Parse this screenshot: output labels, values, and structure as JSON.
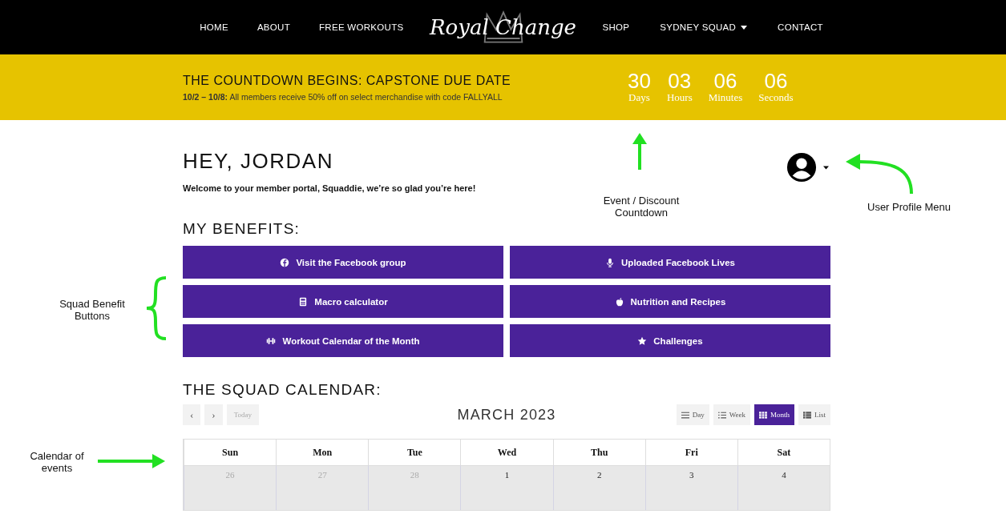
{
  "nav": {
    "left": [
      {
        "label": "HOME",
        "dropdown": false
      },
      {
        "label": "ABOUT",
        "dropdown": false
      },
      {
        "label": "FREE WORKOUTS",
        "dropdown": false
      }
    ],
    "logo": "Royal Change",
    "right": [
      {
        "label": "SHOP",
        "dropdown": false
      },
      {
        "label": "SYDNEY SQUAD",
        "dropdown": true
      },
      {
        "label": "CONTACT",
        "dropdown": false
      }
    ]
  },
  "banner": {
    "title": "THE COUNTDOWN BEGINS: CAPSTONE DUE DATE",
    "note": "**10/2 – 10/8:** All members receive 50% off on select merchandise with code FALLYALL",
    "countdown": [
      {
        "value": "30",
        "unit": "Days"
      },
      {
        "value": "03",
        "unit": "Hours"
      },
      {
        "value": "06",
        "unit": "Minutes"
      },
      {
        "value": "06",
        "unit": "Seconds"
      }
    ]
  },
  "greeting": {
    "title": "HEY, JORDAN",
    "subtitle": "Welcome to your member portal, Squaddie, we’re so glad you’re here!"
  },
  "benefits": {
    "heading": "MY BENEFITS:",
    "buttons": [
      "Visit the Facebook group",
      "Uploaded Facebook Lives",
      "Macro calculator",
      "Nutrition and Recipes",
      "Workout Calendar of the Month",
      "Challenges"
    ]
  },
  "calendar": {
    "heading": "THE SQUAD CALENDAR:",
    "prev": "‹",
    "next": "›",
    "today": "Today",
    "title": "MARCH 2023",
    "views": [
      {
        "label": "Day",
        "selected": false
      },
      {
        "label": "Week",
        "selected": false
      },
      {
        "label": "Month",
        "selected": true
      },
      {
        "label": "List",
        "selected": false
      }
    ],
    "weekdays": [
      "Sun",
      "Mon",
      "Tue",
      "Wed",
      "Thu",
      "Fri",
      "Sat"
    ],
    "days": [
      {
        "label": "26",
        "other_month": true
      },
      {
        "label": "27",
        "other_month": true
      },
      {
        "label": "28",
        "other_month": true
      },
      {
        "label": "1",
        "other_month": false
      },
      {
        "label": "2",
        "other_month": false
      },
      {
        "label": "3",
        "other_month": false
      },
      {
        "label": "4",
        "other_month": false
      }
    ]
  },
  "annotations": {
    "countdown": "Event / Discount Countdown",
    "profile": "User Profile Menu",
    "benefits": "Squad Benefit Buttons",
    "calendar": "Calendar of events"
  }
}
